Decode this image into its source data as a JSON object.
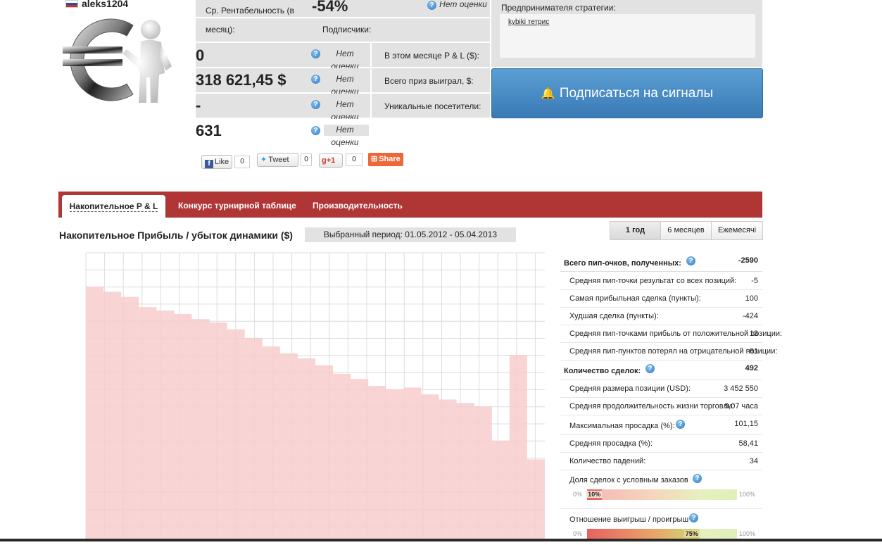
{
  "profile": {
    "username": "aleks1204",
    "flag": "russia-flag",
    "avatar": "euro-figure-avatar"
  },
  "stats": {
    "avg_return_label_line1": "Ср. Рентабельность (в",
    "avg_return_label_line2": "месяц):",
    "avg_return_value": "-54%",
    "subscribers_label": "Подписчики:",
    "rating_na": "Нет оценки",
    "row_this_month_value": "0",
    "row_this_month_label": "В этом месяце P & L ($):",
    "row_total_value": "318 621,45 $",
    "row_total_label": "Всего приз выиграл, $:",
    "row_unique_value": "-",
    "row_unique_label": "Уникальные посетители:",
    "row_count_value": "631"
  },
  "strategy": {
    "label": "Предпринимателя стратегии:",
    "link": "kybiki тетрис"
  },
  "subscribe_button": "Подписаться на сигналы",
  "social": {
    "like": "Like",
    "like_count": "0",
    "tweet": "Tweet",
    "tweet_count": "0",
    "gplus": "+1",
    "gplus_count": "0",
    "share": "Share"
  },
  "tabs": [
    "Накопительное P & L",
    "Конкурс турнирной таблице",
    "Производительность"
  ],
  "chart_section": {
    "title": "Накопительное Прибыль / убыток динамики ($)",
    "period": "Выбранный период: 01.05.2012 - 05.04.2013",
    "range_tabs": [
      "1 год",
      "6 месяцев",
      "Ежемесячі"
    ]
  },
  "chart_data": {
    "type": "area",
    "title": "",
    "xlabel": "",
    "ylabel": "",
    "color": "#f7cdcd",
    "y": [
      0,
      -0.3,
      -0.6,
      -1.2,
      -1.4,
      -1.6,
      -1.9,
      -2.1,
      -2.5,
      -3.0,
      -3.5,
      -3.9,
      -4.2,
      -4.6,
      -5.1,
      -5.4,
      -5.8,
      -6.0,
      -5.9,
      -6.3,
      -6.6,
      -6.8,
      -7.0,
      -9.0,
      -4.0,
      -10.1
    ]
  },
  "pip_stats": {
    "total_label": "Всего пип-очков, полученных:",
    "total_value": "-2590",
    "rows": [
      {
        "label": "Средняя пип-точки результат со всех позиций:",
        "value": "-5"
      },
      {
        "label": "Самая прибыльная сделка (пункты):",
        "value": "100"
      },
      {
        "label": "Худшая сделка (пункты):",
        "value": "-424"
      },
      {
        "label": "Средняя пип-точками прибыль от положительной позиции:",
        "value": "13"
      },
      {
        "label": "Средняя пип-пунктов потерял на отрицательной позиции:",
        "value": "-61"
      }
    ]
  },
  "trade_stats": {
    "count_label": "Количество сделок:",
    "count_value": "492",
    "rows": [
      {
        "label": "Средняя размера позиции (USD):",
        "value": "3 452 550"
      },
      {
        "label": "Средняя продолжительность жизни торговли:",
        "value": "9,07 часа"
      },
      {
        "label": "Максимальная просадка (%):",
        "value": "101,15"
      },
      {
        "label": "Средняя просадка (%):",
        "value": "58,41"
      },
      {
        "label": "Количество падений:",
        "value": "34"
      }
    ]
  },
  "bars": {
    "conditional_label": "Доля сделок с условным заказов",
    "conditional_value": "10%",
    "conditional_fraction": 0.1,
    "winloss_label": "Отношение выигрыш / проигрыш",
    "winloss_value": "75%",
    "winloss_fraction": 0.75,
    "min": "0%",
    "max": "100%"
  }
}
